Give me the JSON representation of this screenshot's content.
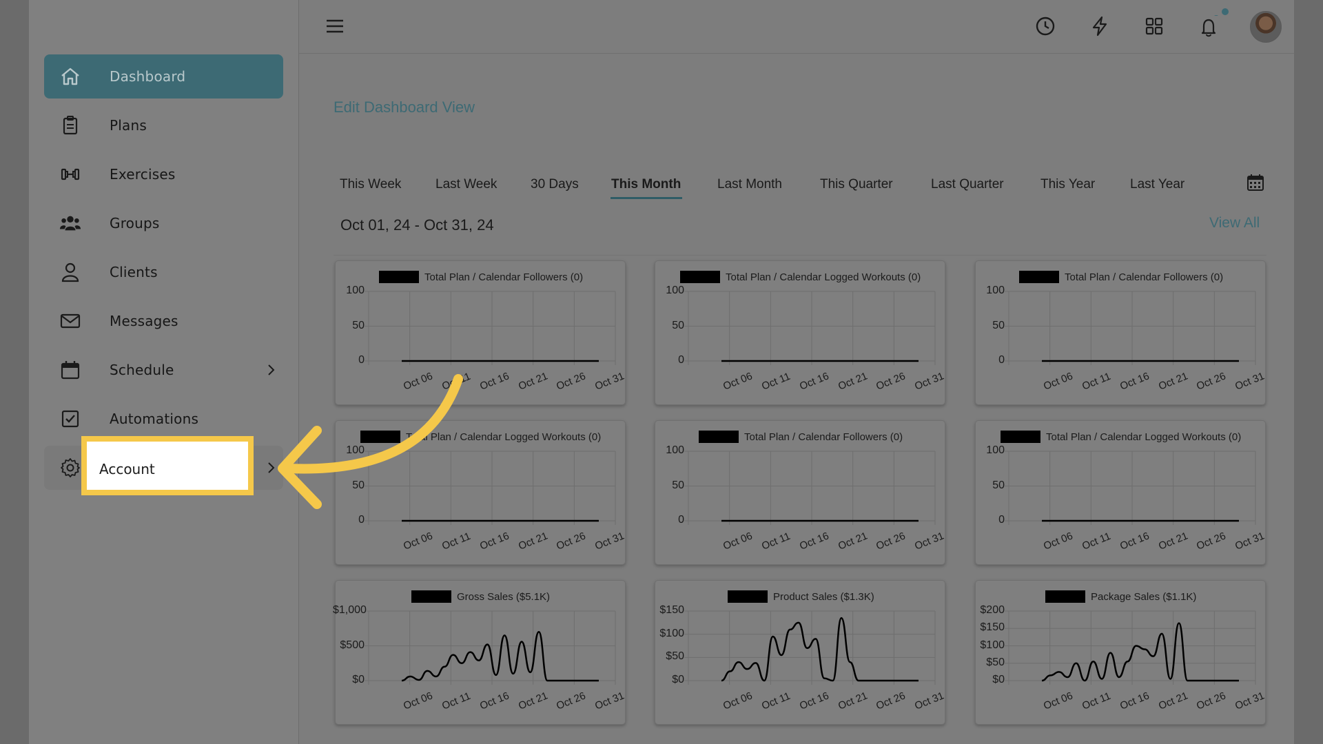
{
  "sidebar": {
    "items": [
      {
        "label": "Dashboard",
        "icon": "home-icon",
        "active": true
      },
      {
        "label": "Plans",
        "icon": "clipboard-icon"
      },
      {
        "label": "Exercises",
        "icon": "dumbbell-icon"
      },
      {
        "label": "Groups",
        "icon": "group-icon"
      },
      {
        "label": "Clients",
        "icon": "person-icon"
      },
      {
        "label": "Messages",
        "icon": "envelope-icon"
      },
      {
        "label": "Schedule",
        "icon": "calendar-icon",
        "has_chevron": true
      },
      {
        "label": "Automations",
        "icon": "checkbox-icon"
      },
      {
        "label": "Account",
        "icon": "gear-icon",
        "has_chevron": true,
        "highlighted": true
      }
    ]
  },
  "topbar": {
    "icons": [
      "menu-icon",
      "clock-icon",
      "lightning-icon",
      "grid-icon",
      "bell-icon",
      "avatar"
    ]
  },
  "main": {
    "edit_link": "Edit Dashboard View",
    "tabs": [
      "This Week",
      "Last Week",
      "30 Days",
      "This Month",
      "Last Month",
      "This Quarter",
      "Last Quarter",
      "This Year",
      "Last Year"
    ],
    "active_tab": "This Month",
    "date_range": "Oct 01, 24 - Oct 31, 24",
    "view_all": "View All"
  },
  "colors": {
    "accent": "#3d6a74",
    "highlight": "#f5c84a"
  },
  "chart_data": [
    {
      "type": "line",
      "title": "Total Plan / Calendar Followers (0)",
      "x": [
        "Oct 06",
        "Oct 11",
        "Oct 16",
        "Oct 21",
        "Oct 26",
        "Oct 31"
      ],
      "yticks": [
        "100",
        "50",
        "0"
      ],
      "ylim": [
        0,
        100
      ],
      "series": [
        {
          "values": [
            0,
            0,
            0,
            0,
            0,
            0
          ]
        }
      ]
    },
    {
      "type": "line",
      "title": "Total Plan / Calendar Logged Workouts (0)",
      "x": [
        "Oct 06",
        "Oct 11",
        "Oct 16",
        "Oct 21",
        "Oct 26",
        "Oct 31"
      ],
      "yticks": [
        "100",
        "50",
        "0"
      ],
      "ylim": [
        0,
        100
      ],
      "series": [
        {
          "values": [
            0,
            0,
            0,
            0,
            0,
            0
          ]
        }
      ]
    },
    {
      "type": "line",
      "title": "Total Plan / Calendar Followers (0)",
      "x": [
        "Oct 06",
        "Oct 11",
        "Oct 16",
        "Oct 21",
        "Oct 26",
        "Oct 31"
      ],
      "yticks": [
        "100",
        "50",
        "0"
      ],
      "ylim": [
        0,
        100
      ],
      "series": [
        {
          "values": [
            0,
            0,
            0,
            0,
            0,
            0
          ]
        }
      ]
    },
    {
      "type": "line",
      "title": "Total Plan / Calendar Logged Workouts (0)",
      "x": [
        "Oct 06",
        "Oct 11",
        "Oct 16",
        "Oct 21",
        "Oct 26",
        "Oct 31"
      ],
      "yticks": [
        "100",
        "50",
        "0"
      ],
      "ylim": [
        0,
        100
      ],
      "series": [
        {
          "values": [
            0,
            0,
            0,
            0,
            0,
            0
          ]
        }
      ]
    },
    {
      "type": "line",
      "title": "Total Plan / Calendar Followers (0)",
      "x": [
        "Oct 06",
        "Oct 11",
        "Oct 16",
        "Oct 21",
        "Oct 26",
        "Oct 31"
      ],
      "yticks": [
        "100",
        "50",
        "0"
      ],
      "ylim": [
        0,
        100
      ],
      "series": [
        {
          "values": [
            0,
            0,
            0,
            0,
            0,
            0
          ]
        }
      ]
    },
    {
      "type": "line",
      "title": "Total Plan / Calendar Logged Workouts (0)",
      "x": [
        "Oct 06",
        "Oct 11",
        "Oct 16",
        "Oct 21",
        "Oct 26",
        "Oct 31"
      ],
      "yticks": [
        "100",
        "50",
        "0"
      ],
      "ylim": [
        0,
        100
      ],
      "series": [
        {
          "values": [
            0,
            0,
            0,
            0,
            0,
            0
          ]
        }
      ]
    },
    {
      "type": "line",
      "title": "Gross Sales ($5.1K)",
      "x": [
        "Oct 06",
        "Oct 11",
        "Oct 16",
        "Oct 21",
        "Oct 26",
        "Oct 31"
      ],
      "yticks": [
        "$1,000",
        "$500",
        "$0"
      ],
      "ylim": [
        0,
        1000
      ],
      "series": [
        {
          "values": [
            0,
            60,
            10,
            140,
            60,
            200,
            370,
            250,
            410,
            290,
            520,
            80,
            650,
            100,
            560,
            120,
            700,
            0,
            0,
            0,
            0,
            0,
            0,
            0
          ]
        }
      ]
    },
    {
      "type": "line",
      "title": "Product Sales ($1.3K)",
      "x": [
        "Oct 06",
        "Oct 11",
        "Oct 16",
        "Oct 21",
        "Oct 26",
        "Oct 31"
      ],
      "yticks": [
        "$150",
        "$100",
        "$50",
        "$0"
      ],
      "ylim": [
        0,
        150
      ],
      "series": [
        {
          "values": [
            0,
            20,
            40,
            25,
            38,
            0,
            95,
            55,
            110,
            125,
            70,
            90,
            5,
            0,
            135,
            40,
            0,
            0,
            0,
            0,
            0,
            0,
            0,
            0
          ]
        }
      ]
    },
    {
      "type": "line",
      "title": "Package Sales ($1.1K)",
      "x": [
        "Oct 06",
        "Oct 11",
        "Oct 16",
        "Oct 21",
        "Oct 26",
        "Oct 31"
      ],
      "yticks": [
        "$200",
        "$150",
        "$100",
        "$50",
        "$0"
      ],
      "ylim": [
        0,
        200
      ],
      "series": [
        {
          "values": [
            0,
            15,
            25,
            10,
            50,
            0,
            55,
            5,
            80,
            10,
            55,
            100,
            90,
            70,
            135,
            5,
            165,
            0,
            0,
            0,
            0,
            0,
            0,
            0
          ]
        }
      ]
    }
  ]
}
